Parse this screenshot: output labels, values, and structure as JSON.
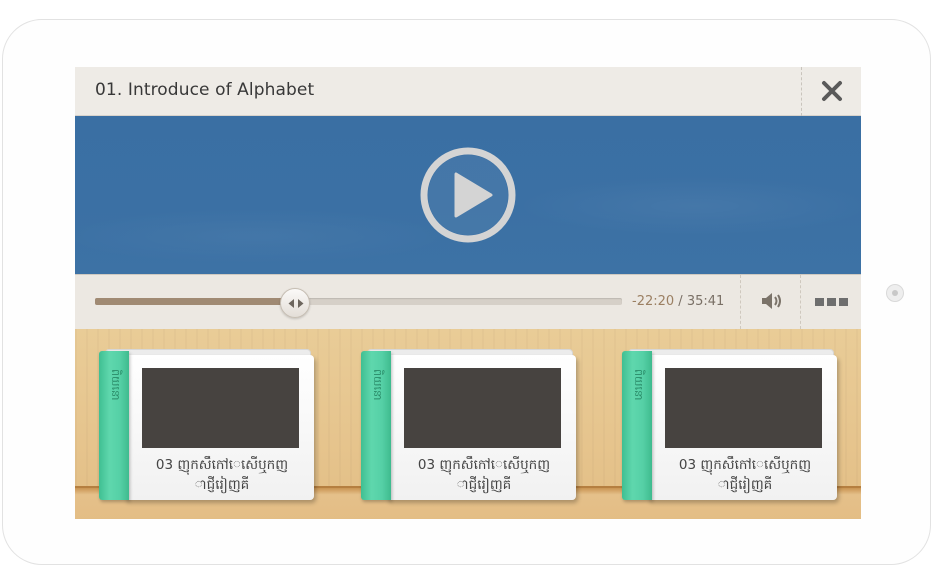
{
  "player": {
    "title": "01. Introduce of Alphabet",
    "progress_fraction": 0.38,
    "time_remaining": "-22:20",
    "time_separator": "/",
    "time_total": "35:41"
  },
  "icons": {
    "close": "close-icon",
    "play": "play-icon",
    "scrub": "scrub-arrows-icon",
    "volume": "volume-icon",
    "menu": "menu-dots-icon"
  },
  "colors": {
    "video_bg": "#3b70a4",
    "progress_fill": "#a08a73",
    "book_spine": "#55d0a6",
    "book_cover": "#474340"
  },
  "books": [
    {
      "spine": "ពិយនោ",
      "title_line1": "03 ញុកសឹកៅេសើឬកញ",
      "title_line2": "ាជ្ញីរៀញគី"
    },
    {
      "spine": "ពិយនោ",
      "title_line1": "03 ញុកសឹកៅេសើឬកញ",
      "title_line2": "ាជ្ញីរៀញគី"
    },
    {
      "spine": "ពិយនោ",
      "title_line1": "03 ញុកសឹកៅេសើឬកញ",
      "title_line2": "ាជ្ញីរៀញគី"
    }
  ]
}
